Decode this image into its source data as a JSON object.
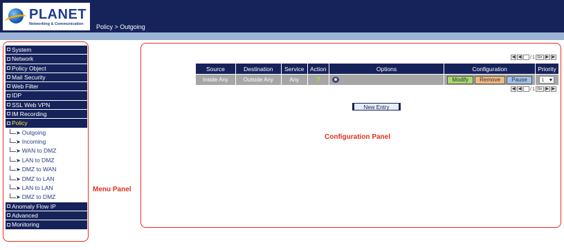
{
  "header": {
    "logo_text": "PLANET",
    "logo_subtext": "Networking & Communication",
    "breadcrumb": "Policy > Outgoing"
  },
  "sidebar": {
    "items_top": [
      "System",
      "Network",
      "Policy Object",
      "Mail Security",
      "Web Filter",
      "IDP",
      "SSL Web VPN",
      "IM Recording"
    ],
    "active_item": "Policy",
    "sub_items": [
      "Outgoing",
      "Incoming",
      "WAN to DMZ",
      "LAN to DMZ",
      "DMZ to WAN",
      "DMZ to LAN",
      "LAN to LAN",
      "DMZ to DMZ"
    ],
    "items_bottom": [
      "Anomaly Flow IP",
      "Advanced",
      "Monitoring"
    ]
  },
  "labels": {
    "menu_panel": "Menu Panel",
    "configuration_panel": "Configuration Panel"
  },
  "pager": {
    "separator": "/",
    "total": "1",
    "go": "Go"
  },
  "table": {
    "headers": {
      "source": "Source",
      "destination": "Destination",
      "service": "Service",
      "action": "Action",
      "options": "Options",
      "configuration": "Configuration",
      "priority": "Priority"
    },
    "row": {
      "source": "Inside Any",
      "destination": "Outside Any",
      "service": "Any",
      "action_icon": "question-mark-icon",
      "action_symbol": "?",
      "options_icon": "eye-icon",
      "priority": "1"
    },
    "buttons": {
      "modify": "Modify",
      "remove": "Remove",
      "pause": "Pause"
    }
  },
  "new_entry_label": "New Entry",
  "colors": {
    "navy": "#16225a",
    "highlight": "#e0301e",
    "active_text": "#ffe23a"
  }
}
